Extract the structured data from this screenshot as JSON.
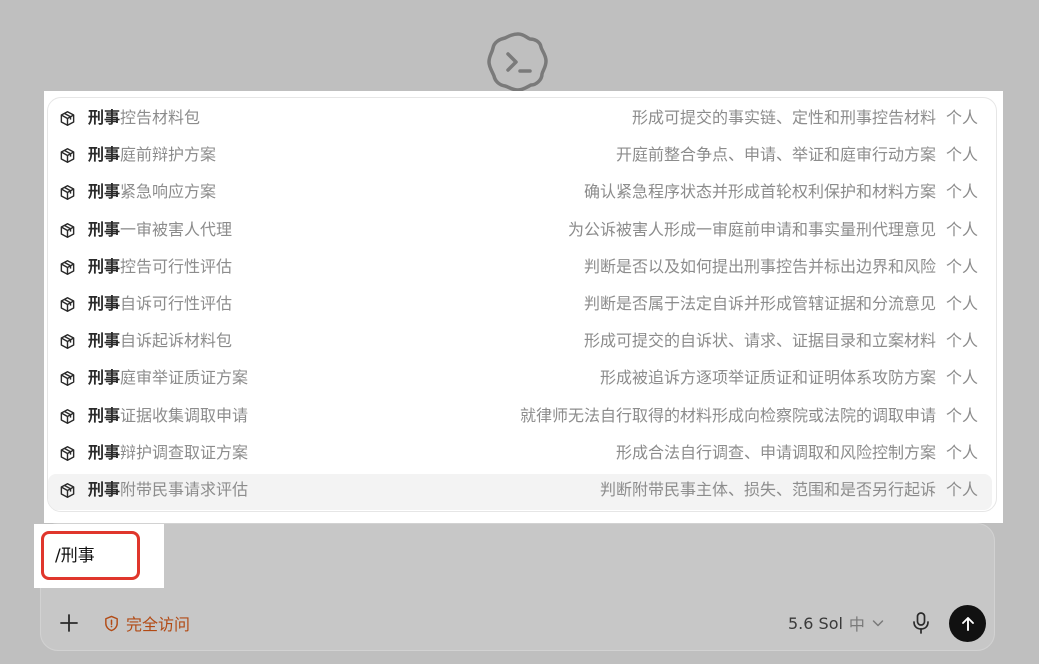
{
  "logo_icon": "codex-cloud-terminal-icon",
  "suggestions": {
    "keyword": "刑事",
    "items": [
      {
        "name_rest": "控告材料包",
        "desc": "形成可提交的事实链、定性和刑事控告材料",
        "scope": "个人"
      },
      {
        "name_rest": "庭前辩护方案",
        "desc": "开庭前整合争点、申请、举证和庭审行动方案",
        "scope": "个人"
      },
      {
        "name_rest": "紧急响应方案",
        "desc": "确认紧急程序状态并形成首轮权利保护和材料方案",
        "scope": "个人"
      },
      {
        "name_rest": "一审被害人代理",
        "desc": "为公诉被害人形成一审庭前申请和事实量刑代理意见",
        "scope": "个人"
      },
      {
        "name_rest": "控告可行性评估",
        "desc": "判断是否以及如何提出刑事控告并标出边界和风险",
        "scope": "个人"
      },
      {
        "name_rest": "自诉可行性评估",
        "desc": "判断是否属于法定自诉并形成管辖证据和分流意见",
        "scope": "个人"
      },
      {
        "name_rest": "自诉起诉材料包",
        "desc": "形成可提交的自诉状、请求、证据目录和立案材料",
        "scope": "个人"
      },
      {
        "name_rest": "庭审举证质证方案",
        "desc": "形成被追诉方逐项举证质证和证明体系攻防方案",
        "scope": "个人"
      },
      {
        "name_rest": "证据收集调取申请",
        "desc": "就律师无法自行取得的材料形成向检察院或法院的调取申请",
        "scope": "个人"
      },
      {
        "name_rest": "辩护调查取证方案",
        "desc": "形成合法自行调查、申请调取和风险控制方案",
        "scope": "个人"
      },
      {
        "name_rest": "附带民事请求评估",
        "desc": "判断附带民事主体、损失、范围和是否另行起诉",
        "scope": "个人",
        "selected": true
      }
    ]
  },
  "composer": {
    "input_value": "/刑事",
    "access_label": "完全访问",
    "model_name": "5.6 Sol",
    "model_level": "中"
  },
  "colors": {
    "background": "#bfbfbf",
    "highlight_border": "#e0362c",
    "access_accent": "#b24a14",
    "send_button": "#111111"
  }
}
